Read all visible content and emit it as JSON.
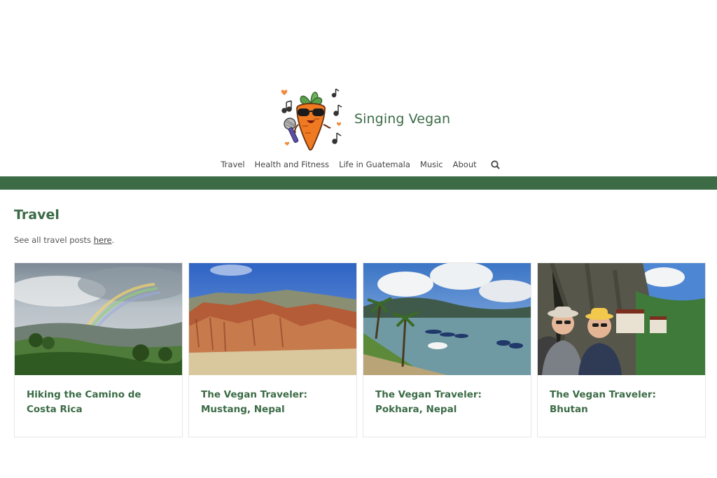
{
  "site": {
    "title": "Singing Vegan",
    "logo_icon": "singing-carrot-logo",
    "accent_color": "#3d6b45"
  },
  "nav": {
    "items": [
      {
        "label": "Travel"
      },
      {
        "label": "Health and Fitness"
      },
      {
        "label": "Life in Guatemala"
      },
      {
        "label": "Music"
      },
      {
        "label": "About"
      }
    ],
    "search_icon": "search-icon"
  },
  "section": {
    "title": "Travel",
    "subtitle_prefix": "See all travel posts ",
    "subtitle_link": "here",
    "subtitle_suffix": "."
  },
  "posts": [
    {
      "title": "Hiking the Camino de Costa Rica",
      "image": "rainbow-over-green-hills"
    },
    {
      "title": "The Vegan Traveler: Mustang, Nepal",
      "image": "red-rock-canyon-cliffs"
    },
    {
      "title": "The Vegan Traveler: Pokhara, Nepal",
      "image": "lake-with-boats-and-palms"
    },
    {
      "title": "The Vegan Traveler: Bhutan",
      "image": "couple-selfie-at-cliff-monastery"
    }
  ]
}
